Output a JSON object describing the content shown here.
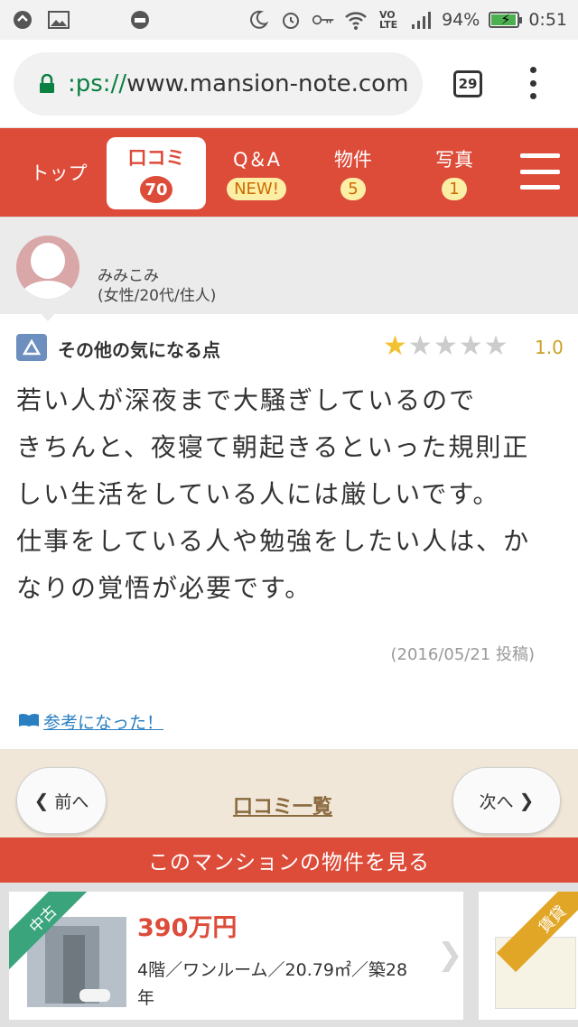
{
  "status_bar": {
    "battery": "94%",
    "battery_level": 0.94,
    "time": "0:51"
  },
  "browser": {
    "url_scheme": ":ps://",
    "url_host": "www.mansion-note.com",
    "tab_count": "29"
  },
  "nav": {
    "top_label": "トップ",
    "reviews_label": "口コミ",
    "reviews_count": "70",
    "qa_label": "Q＆A",
    "qa_badge": "NEW!",
    "properties_label": "物件",
    "properties_count": "5",
    "photos_label": "写真",
    "photos_count": "1"
  },
  "reviewer": {
    "name": "みみこみ",
    "meta": "(女性/20代/住人)"
  },
  "review": {
    "category": "その他の気になる点",
    "rating": 1,
    "rating_max": 5,
    "score_text": "1.0",
    "lines": [
      "若い人が深夜まで大騒ぎしているので",
      "きちんと、夜寝て朝起きるといった規則正",
      "しい生活をしている人には厳しいです。",
      "仕事をしている人や勉強をしたい人は、か",
      "なりの覚悟が必要です。"
    ],
    "date": "(2016/05/21 投稿)",
    "helpful_label": "参考になった！"
  },
  "paging": {
    "prev_label": "前へ",
    "list_label": "口コミ一覧",
    "next_label": "次へ"
  },
  "properties": {
    "banner": "このマンションの物件を見る",
    "cards": [
      {
        "ribbon": "中古",
        "price": "390万円",
        "desc": "4階／ワンルーム／20.79㎡／築28年"
      },
      {
        "ribbon": "賃貸"
      }
    ]
  }
}
